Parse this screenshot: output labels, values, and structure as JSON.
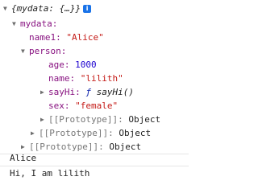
{
  "tree": {
    "root_preview": "{mydata: {…}}",
    "mydata_key": "mydata:",
    "name1": {
      "key": "name1:",
      "value": "\"Alice\""
    },
    "person_key": "person:",
    "age": {
      "key": "age:",
      "value": "1000"
    },
    "name": {
      "key": "name:",
      "value": "\"lilith\""
    },
    "sayHi": {
      "key": "sayHi:",
      "f": "ƒ",
      "value": "sayHi()"
    },
    "sex": {
      "key": "sex:",
      "value": "\"female\""
    },
    "proto_key": "[[Prototype]]:",
    "proto_value": "Object"
  },
  "logs": [
    "Alice",
    "Hi, I am lilith"
  ]
}
